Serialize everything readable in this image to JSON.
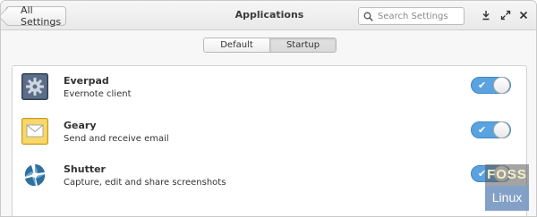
{
  "header": {
    "back_label": "All Settings",
    "title": "Applications",
    "search_placeholder": "Search Settings"
  },
  "tabs": [
    {
      "label": "Default",
      "active": false
    },
    {
      "label": "Startup",
      "active": true
    }
  ],
  "apps": [
    {
      "name": "Everpad",
      "description": "Evernote client",
      "enabled": true,
      "icon": "everpad-gear-icon"
    },
    {
      "name": "Geary",
      "description": "Send and receive email",
      "enabled": true,
      "icon": "geary-mail-icon"
    },
    {
      "name": "Shutter",
      "description": "Capture, edit and share screenshots",
      "enabled": true,
      "icon": "shutter-aperture-icon"
    }
  ],
  "toggle_symbol": "✔",
  "colors": {
    "toggle_on": "#5aa3e0",
    "accent_border": "#3f86c4"
  },
  "watermark": {
    "line1": "FOSS",
    "line2": "Linux"
  }
}
